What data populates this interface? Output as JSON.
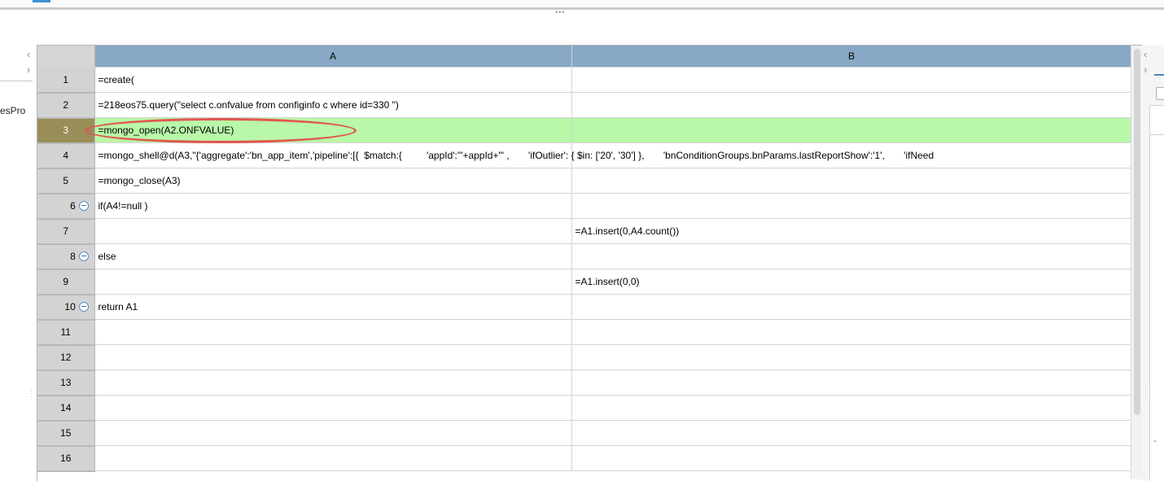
{
  "left_panel": {
    "clipped_text": "esPro"
  },
  "grid": {
    "corner": "",
    "columns": [
      "A",
      "B"
    ],
    "selected_row": 3,
    "rows": [
      {
        "num": "1",
        "a": "=create(",
        "b": "",
        "fold": false
      },
      {
        "num": "2",
        "a": "=218eos75.query(\"select c.onfvalue from configinfo c where id=330 \")",
        "b": "",
        "fold": false
      },
      {
        "num": "3",
        "a": "=mongo_open(A2.ONFVALUE)",
        "b": "",
        "fold": false
      },
      {
        "num": "4",
        "a": "=mongo_shell@d(A3,\"{'aggregate':'bn_app_item','pipeline':[{  $match:{         'appId':'\"+appId+\"' ,       'ifOutlier': { $in: ['20', '30'] },       'bnConditionGroups.bnParams.lastReportShow':'1',       'ifNeed",
        "b": "",
        "fold": false
      },
      {
        "num": "5",
        "a": "=mongo_close(A3)",
        "b": "",
        "fold": false
      },
      {
        "num": "6",
        "a": "if(A4!=null )",
        "b": "",
        "fold": true
      },
      {
        "num": "7",
        "a": "",
        "b": "=A1.insert(0,A4.count())",
        "fold": false
      },
      {
        "num": "8",
        "a": "else",
        "b": "",
        "fold": true
      },
      {
        "num": "9",
        "a": "",
        "b": "=A1.insert(0,0)",
        "fold": false
      },
      {
        "num": "10",
        "a": "return A1",
        "b": "",
        "fold": true
      },
      {
        "num": "11",
        "a": "",
        "b": "",
        "fold": false
      },
      {
        "num": "12",
        "a": "",
        "b": "",
        "fold": false
      },
      {
        "num": "13",
        "a": "",
        "b": "",
        "fold": false
      },
      {
        "num": "14",
        "a": "",
        "b": "",
        "fold": false
      },
      {
        "num": "15",
        "a": "",
        "b": "",
        "fold": false
      },
      {
        "num": "16",
        "a": "",
        "b": "",
        "fold": false
      }
    ]
  },
  "colors": {
    "column_header": "#88a8c6",
    "selected_row_cells": "#b9f7a9",
    "selected_row_number": "#998d58",
    "highlight_ellipse": "#e2564f"
  },
  "icons": [
    "collapse-minus-icon",
    "chevron-left-icon",
    "chevron-right-icon",
    "splitter-grip-icon"
  ]
}
